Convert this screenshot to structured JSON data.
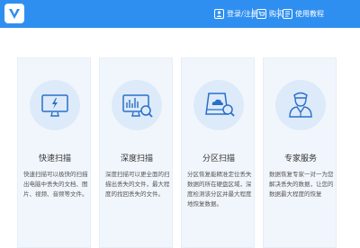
{
  "titlebar": {
    "bg_color": "#2f8ff0",
    "logo_icon": "app-logo-icon",
    "login_label": "登录/注册",
    "buy_label": "购买",
    "tutorial_label": "使用教程"
  },
  "cards": [
    {
      "title": "快速扫描",
      "desc": "快速扫描可以极快的扫描出电脑中丢失的文档、图片、视频、音频等文件。",
      "icon": "monitor-lightning-icon"
    },
    {
      "title": "深度扫描",
      "desc": "深度扫描可以更全面的扫描出丢失的文件，最大程度的找回丢失的文件。",
      "icon": "monitor-chart-icon"
    },
    {
      "title": "分区扫描",
      "desc": "分区恢复能精准定位丢失数据的所在硬盘区域，深度检测该分区并最大程度地恢复数据。",
      "icon": "drive-cloud-icon"
    },
    {
      "title": "专家服务",
      "desc": "数据恢复专家一对一为您解决丢失的数据，让您的数据最大程度的恢复",
      "icon": "expert-person-icon"
    }
  ]
}
